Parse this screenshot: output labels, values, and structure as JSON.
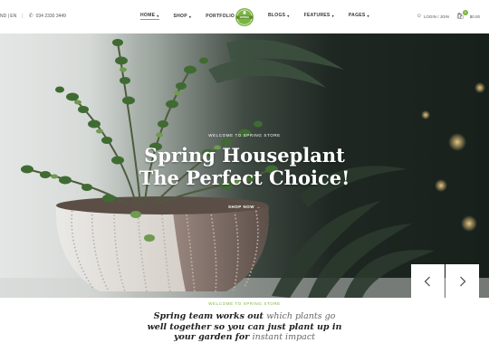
{
  "header": {
    "language": "ND | EN",
    "phone": "034 2330 3449",
    "nav_left": [
      {
        "label": "Home",
        "active": true
      },
      {
        "label": "Shop"
      },
      {
        "label": "Portfolio"
      }
    ],
    "nav_right": [
      {
        "label": "Blogs"
      },
      {
        "label": "Features"
      },
      {
        "label": "Pages"
      }
    ],
    "logo_text": "SPRING",
    "account": "LOGIN / JOIN",
    "cart_count": "0",
    "cart_total": "$0.00"
  },
  "hero": {
    "kicker": "Welcome to Spring Store",
    "title_line1": "Spring Houseplant",
    "title_line2": "The Perfect Choice!",
    "cta": "Shop Now"
  },
  "welcome": {
    "kicker": "Welcome to Spring Store",
    "line1_bold": "Spring team works out",
    "line1_light": "which plants go",
    "line2_bold": "well together so you can just plant up in",
    "line3_bold": "your garden for",
    "line3_light": "instant impact"
  },
  "colors": {
    "accent": "#7cb342",
    "hero_dark": "#18201b"
  },
  "icons": [
    "phone-icon",
    "user-icon",
    "shopping-bag-icon",
    "chevron-left-icon",
    "chevron-right-icon",
    "arrow-right-icon"
  ]
}
